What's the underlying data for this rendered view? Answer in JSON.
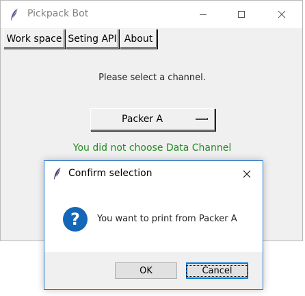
{
  "main_window": {
    "title": "Pickpack Bot",
    "icon": "feather-icon",
    "controls": [
      "minimize-icon",
      "maximize-icon",
      "close-icon"
    ]
  },
  "tabs": [
    {
      "label": "Work space"
    },
    {
      "label": "Seting API"
    },
    {
      "label": "About"
    }
  ],
  "workspace": {
    "prompt": "Please select a channel.",
    "channel_selected": "Packer A",
    "status_message": "You did not choose Data Channel"
  },
  "dialog": {
    "title": "Confirm selection",
    "icon": "question-icon",
    "question_glyph": "?",
    "message": "You want to print from Packer A",
    "ok_label": "OK",
    "cancel_label": "Cancel"
  },
  "colors": {
    "status_green": "#228b22",
    "dialog_border": "#2b79c9",
    "question_icon_bg": "#1466b8",
    "default_button_border": "#0078d7"
  }
}
